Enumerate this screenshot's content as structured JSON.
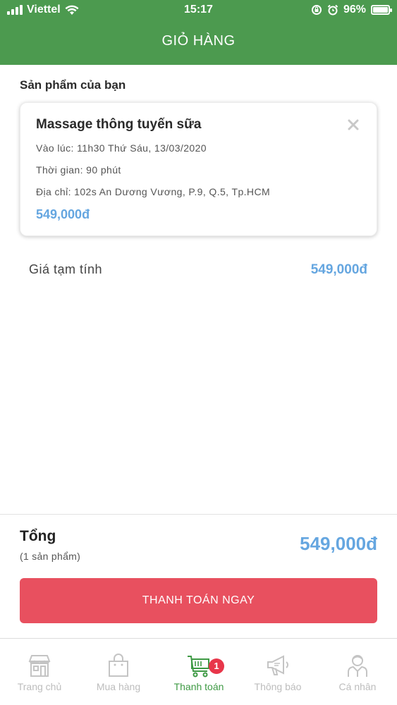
{
  "status_bar": {
    "carrier": "Viettel",
    "time": "15:17",
    "battery": "96%"
  },
  "header": {
    "title": "GIỎ HÀNG"
  },
  "cart": {
    "section_title": "Sản phẩm của bạn",
    "item": {
      "name": "Massage thông tuyến sữa",
      "datetime": "Vào lúc: 11h30 Thứ Sáu, 13/03/2020",
      "duration": "Thời gian: 90 phút",
      "address": "Địa chỉ: 102s An Dương Vương, P.9, Q.5, Tp.HCM",
      "price": "549,000đ"
    },
    "subtotal_label": "Giá tạm tính",
    "subtotal_value": "549,000đ"
  },
  "summary": {
    "total_label": "Tổng",
    "item_count": "(1 sản phẩm)",
    "total_value": "549,000đ",
    "pay_button": "THANH TOÁN NGAY"
  },
  "tabbar": {
    "items": [
      {
        "label": "Trang chủ",
        "icon": "store-icon",
        "active": false
      },
      {
        "label": "Mua hàng",
        "icon": "shopping-bag-icon",
        "active": false
      },
      {
        "label": "Thanh toán",
        "icon": "cart-icon",
        "active": true,
        "badge": "1"
      },
      {
        "label": "Thông báo",
        "icon": "megaphone-icon",
        "active": false
      },
      {
        "label": "Cá nhân",
        "icon": "person-icon",
        "active": false
      }
    ]
  },
  "colors": {
    "header_green": "#4c9a4f",
    "price_blue": "#65a6e0",
    "pay_red": "#e8505f",
    "active_green": "#3f9a45",
    "badge_red": "#e8364a"
  }
}
